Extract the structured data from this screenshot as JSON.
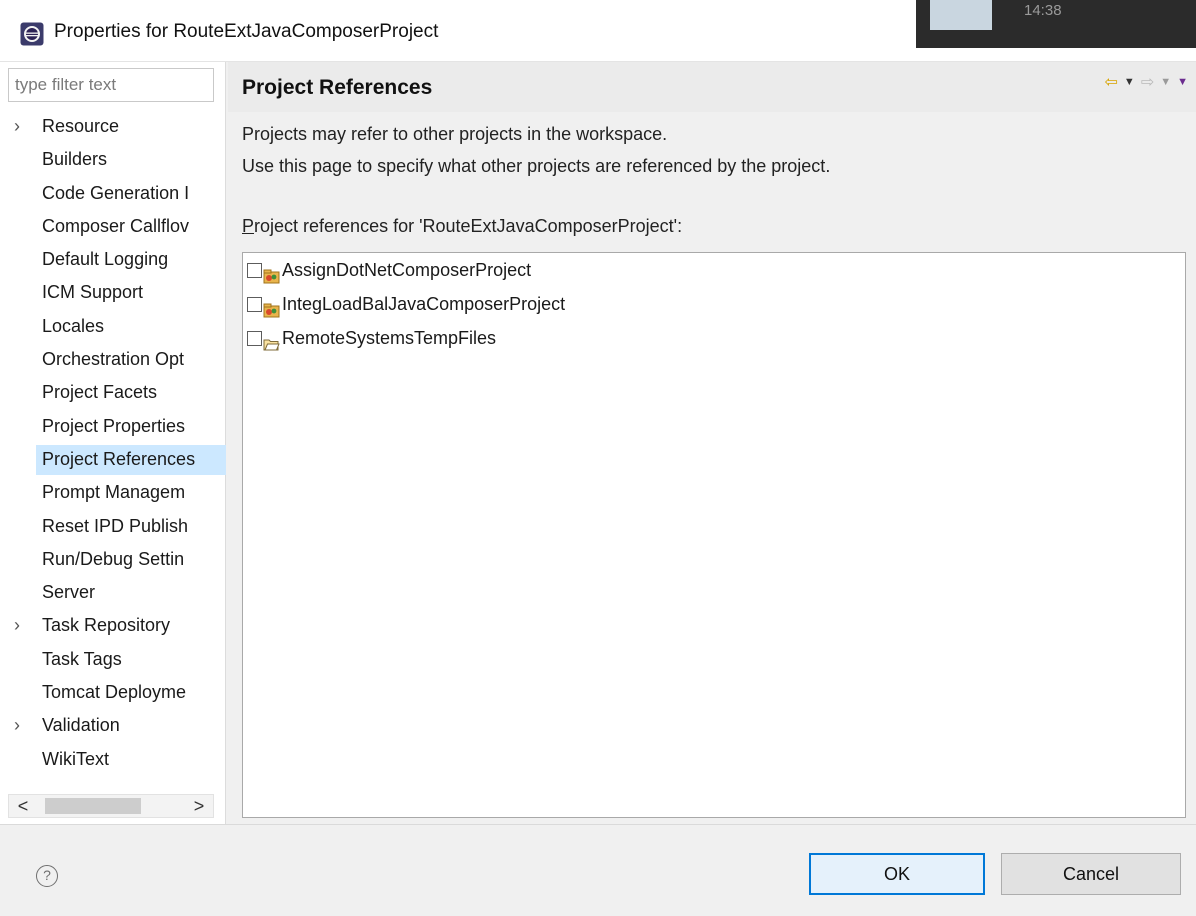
{
  "window": {
    "title": "Properties for RouteExtJavaComposerProject",
    "app_icon": "eclipse-icon"
  },
  "taskbar_peek": {
    "clock": "14:38"
  },
  "left_nav": {
    "filter": {
      "placeholder": "type filter text",
      "value": ""
    },
    "items": [
      {
        "label": "Resource",
        "expandable": true,
        "selected": false
      },
      {
        "label": "Builders",
        "expandable": false,
        "selected": false
      },
      {
        "label": "Code Generation I",
        "expandable": false,
        "selected": false
      },
      {
        "label": "Composer Callflov",
        "expandable": false,
        "selected": false
      },
      {
        "label": "Default Logging",
        "expandable": false,
        "selected": false
      },
      {
        "label": "ICM Support",
        "expandable": false,
        "selected": false
      },
      {
        "label": "Locales",
        "expandable": false,
        "selected": false
      },
      {
        "label": "Orchestration Opt",
        "expandable": false,
        "selected": false
      },
      {
        "label": "Project Facets",
        "expandable": false,
        "selected": false
      },
      {
        "label": "Project Properties",
        "expandable": false,
        "selected": false
      },
      {
        "label": "Project References",
        "expandable": false,
        "selected": true
      },
      {
        "label": "Prompt Managem",
        "expandable": false,
        "selected": false
      },
      {
        "label": "Reset IPD Publish",
        "expandable": false,
        "selected": false
      },
      {
        "label": "Run/Debug Settin",
        "expandable": false,
        "selected": false
      },
      {
        "label": "Server",
        "expandable": false,
        "selected": false
      },
      {
        "label": "Task Repository",
        "expandable": true,
        "selected": false
      },
      {
        "label": "Task Tags",
        "expandable": false,
        "selected": false
      },
      {
        "label": "Tomcat Deployme",
        "expandable": false,
        "selected": false
      },
      {
        "label": "Validation",
        "expandable": true,
        "selected": false
      },
      {
        "label": "WikiText",
        "expandable": false,
        "selected": false
      }
    ],
    "expander_glyph": "›",
    "scroll_left": "<",
    "scroll_right": ">"
  },
  "page": {
    "title": "Project References",
    "description_line1": "Projects may refer to other projects in the workspace.",
    "description_line2": "Use this page to specify what other projects are referenced by the project.",
    "refs_label_mnemonic": "P",
    "refs_label_rest": "roject references for 'RouteExtJavaComposerProject':",
    "references": [
      {
        "name": "AssignDotNetComposerProject",
        "checked": false,
        "icon": "composer-project-icon"
      },
      {
        "name": "IntegLoadBalJavaComposerProject",
        "checked": false,
        "icon": "composer-project-icon"
      },
      {
        "name": "RemoteSystemsTempFiles",
        "checked": false,
        "icon": "open-folder-icon"
      }
    ]
  },
  "buttons": {
    "ok": "OK",
    "cancel": "Cancel",
    "help": "?"
  },
  "colors": {
    "selection": "#cce8ff",
    "default_button_border": "#0078d7",
    "back_arrow": "#d7a300"
  }
}
